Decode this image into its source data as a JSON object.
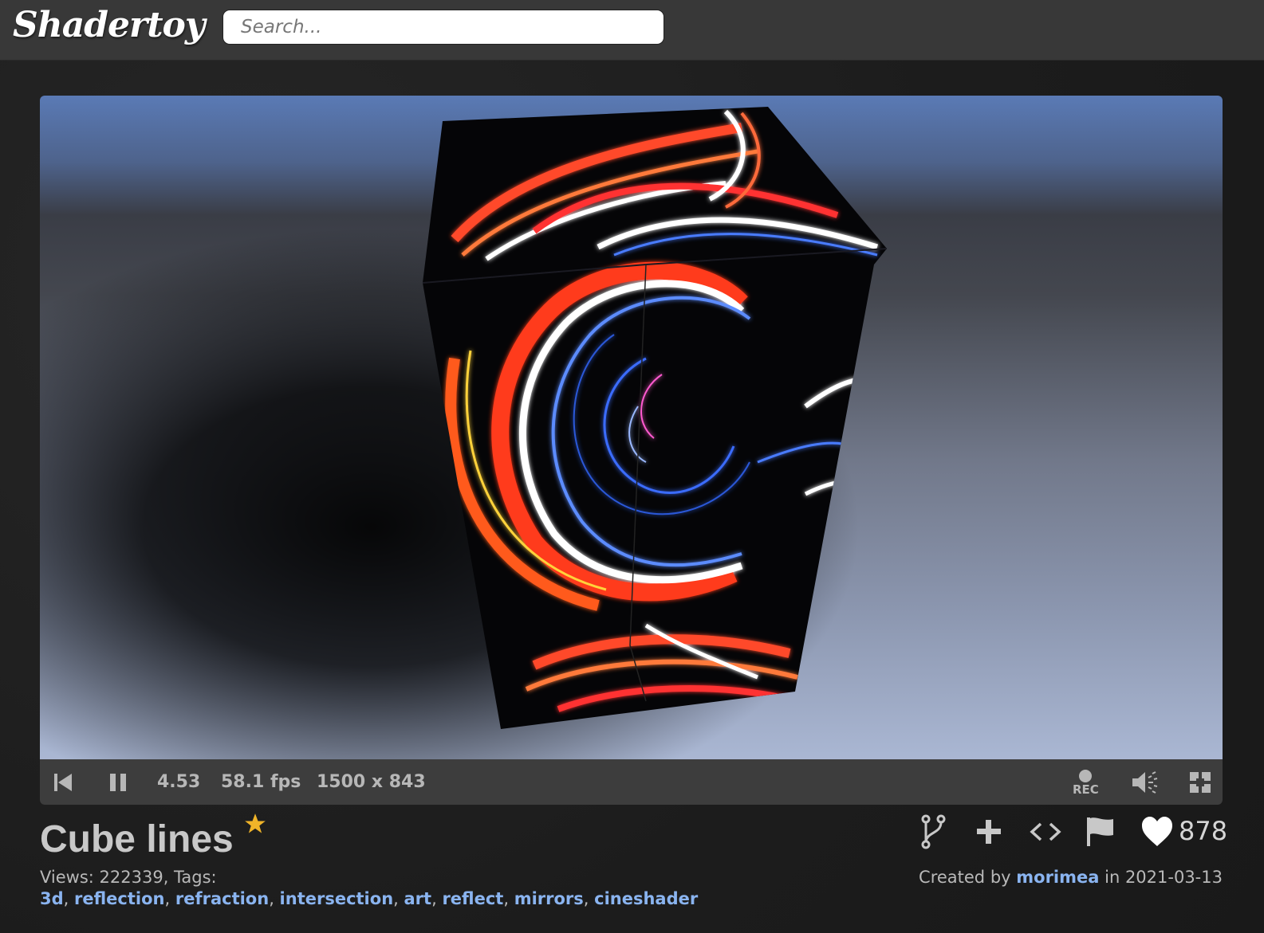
{
  "header": {
    "logo_text": "Shadertoy",
    "search_placeholder": "Search..."
  },
  "player": {
    "time": "4.53",
    "fps": "58.1 fps",
    "resolution": "1500 x 843",
    "rec_label": "REC",
    "icons": [
      "rewind-icon",
      "pause-icon",
      "record-icon",
      "volume-icon",
      "fullscreen-icon"
    ]
  },
  "shader": {
    "title": "Cube lines",
    "views_label": "Views: 222339, Tags:",
    "tags": [
      "3d",
      "reflection",
      "refraction",
      "intersection",
      "art",
      "reflect",
      "mirrors",
      "cineshader"
    ],
    "likes": "878",
    "created_prefix": "Created by",
    "author": "morimea",
    "date_text": "in 2021-03-13"
  },
  "colors": {
    "link": "#8ab4f0",
    "topbar": "#383838",
    "star": "#f0b429"
  }
}
